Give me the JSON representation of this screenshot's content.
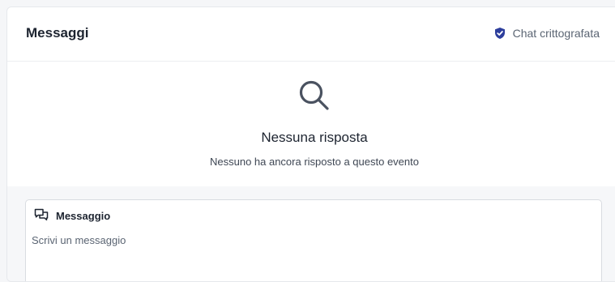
{
  "header": {
    "title": "Messaggi",
    "encryption_label": "Chat crittografata",
    "encryption_icon": "shield-check-icon",
    "encryption_icon_color": "#2d3e9c"
  },
  "empty_state": {
    "icon": "search-icon",
    "title": "Nessuna risposta",
    "subtitle": "Nessuno ha ancora risposto a questo evento"
  },
  "composer": {
    "icon": "chat-bubbles-icon",
    "label": "Messaggio",
    "placeholder": "Scrivi un messaggio",
    "value": ""
  }
}
